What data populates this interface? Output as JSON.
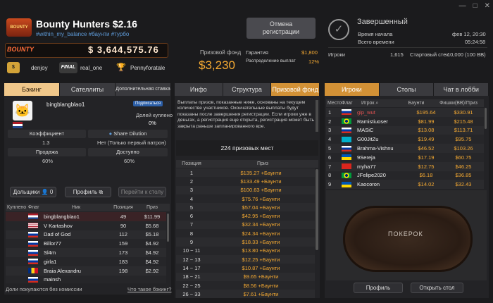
{
  "window": {
    "controls": [
      "—",
      "□",
      "✕"
    ]
  },
  "header": {
    "title": "Bounty Hunters $2.16",
    "tags": "#within_my_balance #баунти #турбо",
    "logo_text": "BOUNTY",
    "bounty_label": "BOUNTY",
    "bounty_amount": "$ 3,644,575.76",
    "winners": [
      {
        "name": "denjoy",
        "icon": "$",
        "color": "#d3a338"
      },
      {
        "name": "real_one",
        "icon": "FINAL",
        "color": "#444"
      },
      {
        "name": "Pennyforatale",
        "icon": "🏆",
        "color": "#2a2a2a"
      }
    ],
    "cancel_button": "Отмена\nрегистрации",
    "prize_fund_label": "Призовой фонд",
    "prize_fund_value": "$3,230",
    "guarantee_label": "Гарантия",
    "guarantee_value": "$1,800",
    "distribution_label": "Распределение выплат",
    "distribution_value": "12%",
    "status": "Завершенный",
    "start_label": "Время начала",
    "start_value": "фев 12, 20:30",
    "total_time_label": "Всего времени",
    "total_time_value": "05:24:58",
    "players_label": "Игроки",
    "players_value": "1,615",
    "stack_label": "Стартовый стек",
    "stack_value": "10,000 (100 BB)"
  },
  "left": {
    "tabs": [
      "Бэкинг",
      "Сателлиты",
      "Дополнительная ставка"
    ],
    "player": "bingblangblao1",
    "badge": "Подписаться",
    "share_label": "Долей куплено",
    "share_value": "0%",
    "coef_label": "Коэффициент",
    "coef_value": "1.3",
    "dilution_label": "Share Dilution",
    "dilution_value": "Нет (Только первый патрон)",
    "sale_label": "Продажа",
    "sale_value": "60%",
    "available_label": "Доступно",
    "available_value": "60%",
    "shareholders_button": "Дольщики",
    "shareholders_count": "0",
    "profile_button": "Профиль",
    "table_button": "Перейти к столу",
    "cols": [
      "Куплено",
      "Флаг",
      "Ник",
      "Позиция",
      "Приз"
    ],
    "rows": [
      {
        "name": "bingblangblao1",
        "pos": "49",
        "prize": "$11.99",
        "flag": "nl"
      },
      {
        "name": "V Kartashov",
        "pos": "90",
        "prize": "$5.68",
        "flag": "us"
      },
      {
        "name": "Dad of God",
        "pos": "112",
        "prize": "$5.18",
        "flag": "ru"
      },
      {
        "name": "Billor77",
        "pos": "159",
        "prize": "$4.92",
        "flag": "ru"
      },
      {
        "name": "Sl4m",
        "pos": "173",
        "prize": "$4.92",
        "flag": "ru"
      },
      {
        "name": "girla1",
        "pos": "183",
        "prize": "$4.92",
        "flag": "ru"
      },
      {
        "name": "Braia Alexandru",
        "pos": "198",
        "prize": "$2.92",
        "flag": "ro"
      },
      {
        "name": "mainsh",
        "pos": "",
        "prize": "",
        "flag": "ru"
      }
    ],
    "footer_left": "Доли покупаются без комиссии",
    "footer_link": "Что такое бэкинг?"
  },
  "middle": {
    "tabs": [
      "Инфо",
      "Структура",
      "Призовой фонд"
    ],
    "info_text": "Выплаты призов, показанные ниже, основаны на текущем количестве участников. Окончательные выплаты будут показаны после завершения регистрации. Если игроки уже в деньгах, а регистрация еще открыта, регистрация может быть закрыта раньше запланированного вре.",
    "places": "224 призовых мест",
    "cols": [
      "Позиция",
      "Приз"
    ],
    "rows": [
      {
        "pos": "1",
        "prize": "$135.27 +Баунти"
      },
      {
        "pos": "2",
        "prize": "$133.49 +Баунти"
      },
      {
        "pos": "3",
        "prize": "$100.63 +Баунти"
      },
      {
        "pos": "4",
        "prize": "$75.76 +Баунти"
      },
      {
        "pos": "5",
        "prize": "$57.04 +Баунти"
      },
      {
        "pos": "6",
        "prize": "$42.95 +Баунти"
      },
      {
        "pos": "7",
        "prize": "$32.34 +Баунти"
      },
      {
        "pos": "8",
        "prize": "$24.34 +Баунти"
      },
      {
        "pos": "9",
        "prize": "$18.33 +Баунти"
      },
      {
        "pos": "10 ~ 11",
        "prize": "$13.80 +Баунти"
      },
      {
        "pos": "12 ~ 13",
        "prize": "$12.25 +Баунти"
      },
      {
        "pos": "14 ~ 17",
        "prize": "$10.87 +Баунти"
      },
      {
        "pos": "18 ~ 21",
        "prize": "$9.65 +Баунти"
      },
      {
        "pos": "22 ~ 25",
        "prize": "$8.56 +Баунти"
      },
      {
        "pos": "26 ~ 33",
        "prize": "$7.61 +Баунти"
      }
    ]
  },
  "right": {
    "tabs": [
      "Игроки",
      "Столы",
      "Чат в лобби"
    ],
    "cols": [
      "Место",
      "Флаг",
      "Игрок",
      "Баунти",
      "Фишки(BB)/Приз"
    ],
    "rows": [
      {
        "pos": "1",
        "name": "gip_wut",
        "bounty": "$195.64",
        "prize": "$330.91",
        "flag": "ru",
        "red": true
      },
      {
        "pos": "2",
        "name": "Ramistiuoser",
        "bounty": "$81.99",
        "prize": "$215.48",
        "flag": "br",
        "red": false
      },
      {
        "pos": "3",
        "name": "MASiC",
        "bounty": "$13.08",
        "prize": "$113.71",
        "flag": "ru",
        "red": false
      },
      {
        "pos": "4",
        "name": "G00JitZu",
        "bounty": "$19.49",
        "prize": "$95.75",
        "flag": "kz",
        "red": false
      },
      {
        "pos": "5",
        "name": "Brahma-Vishnu",
        "bounty": "$46.52",
        "prize": "$103.26",
        "flag": "ru",
        "red": false
      },
      {
        "pos": "6",
        "name": "9Sereja",
        "bounty": "$17.19",
        "prize": "$60.75",
        "flag": "ua",
        "red": false
      },
      {
        "pos": "7",
        "name": "myha77",
        "bounty": "$12.75",
        "prize": "$46.25",
        "flag": "vn",
        "red": false
      },
      {
        "pos": "8",
        "name": "JFelipe2020",
        "bounty": "$6.18",
        "prize": "$36.85",
        "flag": "br",
        "red": false
      },
      {
        "pos": "9",
        "name": "Kaocoron",
        "bounty": "$14.02",
        "prize": "$32.43",
        "flag": "ua",
        "red": false
      }
    ],
    "table_logo": "ПОКЕРОК",
    "profile_button": "Профиль",
    "open_table_button": "Открыть стол"
  }
}
